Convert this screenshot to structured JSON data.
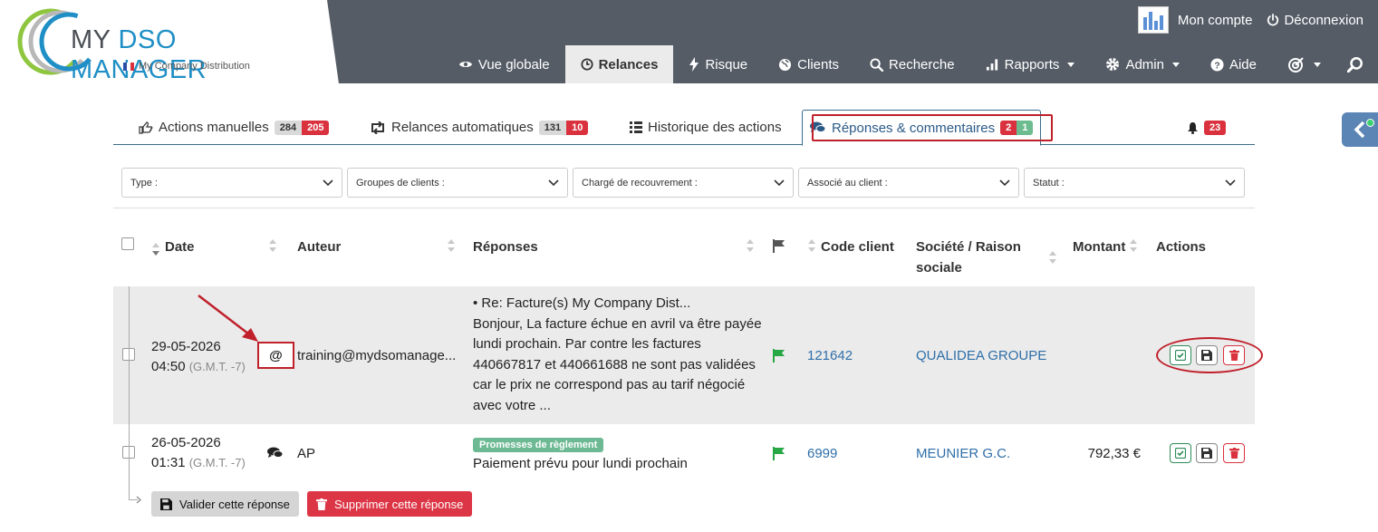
{
  "brand": {
    "name_plain": "MY ",
    "name_accent_1": "DSO",
    "name_accent_2": " MANAGER",
    "company": "My Company Distribution"
  },
  "account": {
    "my_account": "Mon compte",
    "logout": "Déconnexion"
  },
  "nav": [
    {
      "label": "Vue globale",
      "icon": "eye-icon"
    },
    {
      "label": "Relances",
      "icon": "clock-icon",
      "active": true
    },
    {
      "label": "Risque",
      "icon": "bolt-icon"
    },
    {
      "label": "Clients",
      "icon": "globe-icon"
    },
    {
      "label": "Recherche",
      "icon": "search-icon"
    },
    {
      "label": "Rapports",
      "icon": "bar-chart-icon",
      "dropdown": true
    },
    {
      "label": "Admin",
      "icon": "gear-icon",
      "dropdown": true
    },
    {
      "label": "Aide",
      "icon": "question-icon"
    }
  ],
  "tabs": {
    "manual": {
      "label": "Actions manuelles",
      "count_a": "284",
      "count_b": "205"
    },
    "auto": {
      "label": "Relances automatiques",
      "count_a": "131",
      "count_b": "10"
    },
    "history": {
      "label": "Historique des actions"
    },
    "replies": {
      "label": "Réponses & commentaires",
      "count_a": "2",
      "count_b": "1"
    },
    "notifications": {
      "count": "23"
    }
  },
  "filters": [
    "Type :",
    "Groupes de clients :",
    "Chargé de recouvrement :",
    "Associé au client :",
    "Statut :"
  ],
  "columns": {
    "date": "Date",
    "author": "Auteur",
    "replies": "Réponses",
    "client_code": "Code client",
    "company": "Société / Raison",
    "company_2": "sociale",
    "amount": "Montant",
    "actions": "Actions"
  },
  "rows": [
    {
      "date": "29-05-2026",
      "time": "04:50",
      "tz": "(G.M.T. -7)",
      "author": "training@mydsomanage...",
      "reply_subject": "• Re: Facture(s) My Company Dist...",
      "reply_body": "Bonjour, La facture échue en avril va être payée lundi prochain. Par contre les factures 440667817 et 440661688 ne sont pas validées car le prix ne correspond pas au tarif négocié avec votre ...",
      "client_code": "121642",
      "company": "QUALIDEA GROUPE",
      "amount": ""
    },
    {
      "date": "26-05-2026",
      "time": "01:31",
      "tz": "(G.M.T. -7)",
      "author": "AP",
      "tag": "Promesses de règlement",
      "reply_body": "Paiement prévu pour lundi prochain",
      "client_code": "6999",
      "company": "MEUNIER G.C.",
      "amount": "792,33 €"
    }
  ],
  "buttons": {
    "validate": "Valider cette réponse",
    "delete": "Supprimer cette réponse"
  },
  "colors": {
    "topbar": "#555c66",
    "accent_blue": "#1f8fc6",
    "danger": "#d9323e",
    "success": "#6dbc8f",
    "link": "#2f6fa8"
  }
}
